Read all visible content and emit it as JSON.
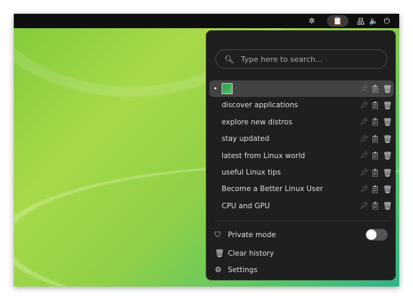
{
  "topbar": {
    "icons": [
      "extension-icon",
      "clipboard-icon",
      "network-icon",
      "volume-icon",
      "power-icon"
    ]
  },
  "menu": {
    "search_placeholder": "Type here to search...",
    "items": [
      {
        "label": "",
        "type": "image"
      },
      {
        "label": "discover applications"
      },
      {
        "label": "explore new distros"
      },
      {
        "label": "stay updated"
      },
      {
        "label": "latest from Linux world"
      },
      {
        "label": "useful Linux tips"
      },
      {
        "label": "Become a Better Linux User"
      },
      {
        "label": "CPU and GPU"
      }
    ],
    "private_mode": "Private mode",
    "private_mode_on": false,
    "clear_history": "Clear history",
    "settings": "Settings"
  }
}
